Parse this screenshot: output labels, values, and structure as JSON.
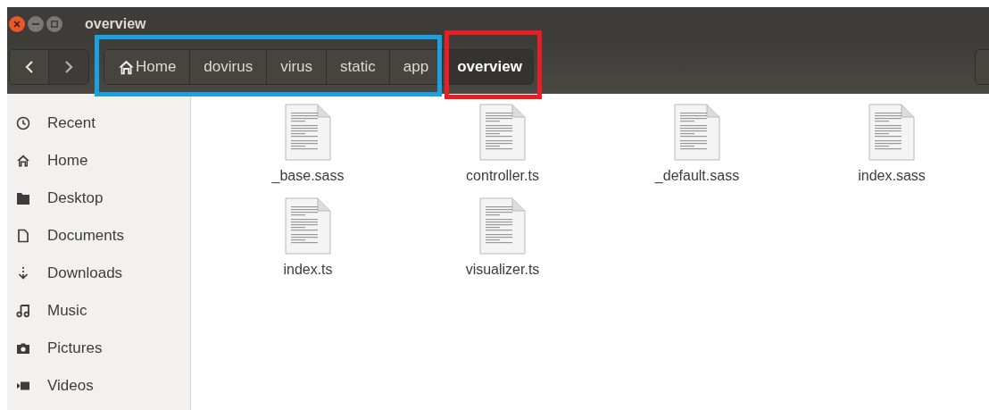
{
  "window": {
    "title": "overview"
  },
  "path_bar": [
    {
      "label": "Home",
      "kind": "home",
      "selected": false
    },
    {
      "label": "dovirus",
      "kind": "folder",
      "selected": false
    },
    {
      "label": "virus",
      "kind": "folder",
      "selected": false
    },
    {
      "label": "static",
      "kind": "folder",
      "selected": false
    },
    {
      "label": "app",
      "kind": "folder",
      "selected": false
    },
    {
      "label": "overview",
      "kind": "folder",
      "selected": true
    }
  ],
  "sidebar": {
    "items": [
      {
        "label": "Recent",
        "kind": "recent"
      },
      {
        "label": "Home",
        "kind": "home"
      },
      {
        "label": "Desktop",
        "kind": "desktop"
      },
      {
        "label": "Documents",
        "kind": "documents"
      },
      {
        "label": "Downloads",
        "kind": "downloads"
      },
      {
        "label": "Music",
        "kind": "music"
      },
      {
        "label": "Pictures",
        "kind": "pictures"
      },
      {
        "label": "Videos",
        "kind": "videos"
      }
    ]
  },
  "files": [
    {
      "name": "_base.sass"
    },
    {
      "name": "controller.ts"
    },
    {
      "name": "_default.sass"
    },
    {
      "name": "index.sass"
    },
    {
      "name": "index.ts"
    },
    {
      "name": "visualizer.ts"
    }
  ]
}
